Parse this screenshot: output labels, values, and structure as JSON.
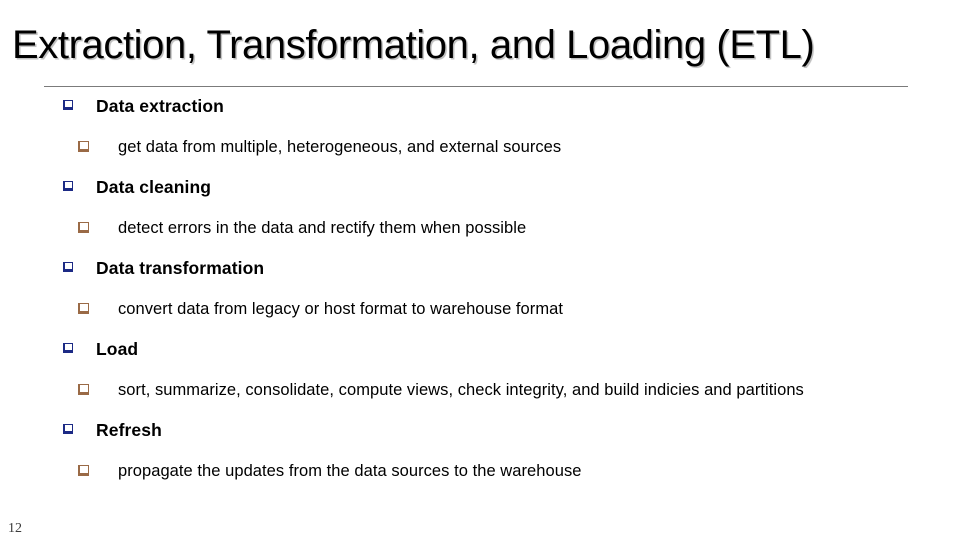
{
  "slide": {
    "title": "Extraction, Transformation, and Loading (ETL)",
    "page_number": "12",
    "background_color": "#ffffff",
    "title_color": "#000000",
    "rule_color": "#7b7b7b",
    "level1_bullet_color": "#1c2a85",
    "level2_bullet_color": "#9a6a46",
    "level1_bullet_glyph": "hollow-square",
    "level2_bullet_glyph": "hollow-square"
  },
  "content": {
    "items": [
      {
        "level": 1,
        "text": "Data extraction"
      },
      {
        "level": 2,
        "text": "get data from multiple, heterogeneous, and external sources"
      },
      {
        "level": 1,
        "text": "Data cleaning"
      },
      {
        "level": 2,
        "text": "detect errors in the data and rectify them when possible"
      },
      {
        "level": 1,
        "text": "Data transformation"
      },
      {
        "level": 2,
        "text": "convert data from legacy or host format to warehouse format"
      },
      {
        "level": 1,
        "text": "Load"
      },
      {
        "level": 2,
        "text": "sort, summarize, consolidate, compute views, check integrity, and build indicies and partitions"
      },
      {
        "level": 1,
        "text": "Refresh"
      },
      {
        "level": 2,
        "text": "propagate the updates from the data sources to the warehouse"
      }
    ]
  }
}
